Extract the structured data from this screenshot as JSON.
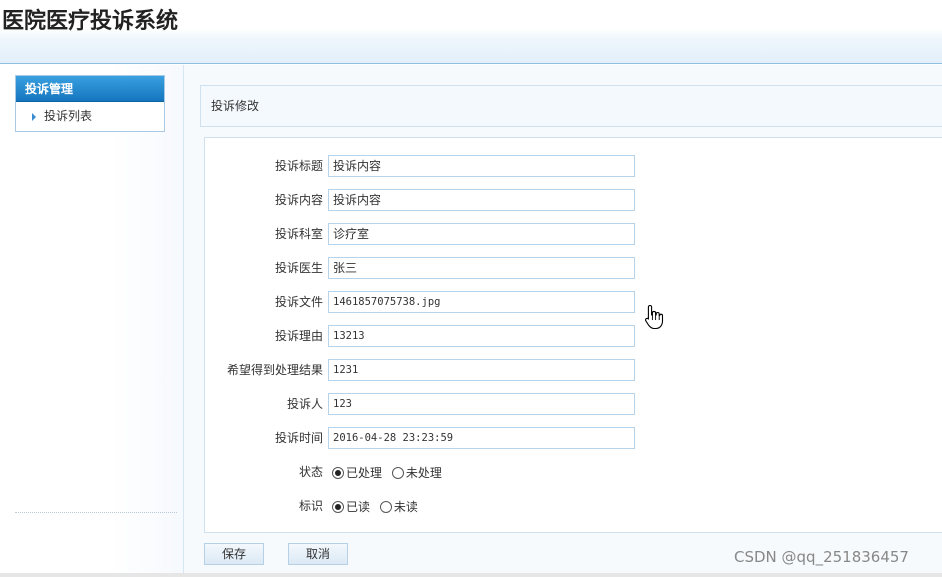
{
  "app": {
    "title": "医院医疗投诉系统"
  },
  "sidebar": {
    "menu_title": "投诉管理",
    "items": [
      {
        "label": "投诉列表"
      }
    ]
  },
  "panel": {
    "title": "投诉修改"
  },
  "form": {
    "fields": [
      {
        "label": "投诉标题",
        "value": "投诉内容"
      },
      {
        "label": "投诉内容",
        "value": "投诉内容"
      },
      {
        "label": "投诉科室",
        "value": "诊疗室"
      },
      {
        "label": "投诉医生",
        "value": "张三"
      },
      {
        "label": "投诉文件",
        "value": "1461857075738.jpg"
      },
      {
        "label": "投诉理由",
        "value": "13213"
      },
      {
        "label": "希望得到处理结果",
        "value": "1231"
      },
      {
        "label": "投诉人",
        "value": "123"
      },
      {
        "label": "投诉时间",
        "value": "2016-04-28 23:23:59"
      }
    ],
    "status": {
      "label": "状态",
      "options": [
        {
          "label": "已处理",
          "checked": true
        },
        {
          "label": "未处理",
          "checked": false
        }
      ]
    },
    "read_flag": {
      "label": "标识",
      "options": [
        {
          "label": "已读",
          "checked": true
        },
        {
          "label": "未读",
          "checked": false
        }
      ]
    }
  },
  "buttons": {
    "save": "保存",
    "cancel": "取消"
  },
  "watermark": "CSDN @qq_251836457",
  "icons": {
    "cursor": "hand-pointer-icon",
    "menu_arrow": "triangle-right-icon"
  }
}
